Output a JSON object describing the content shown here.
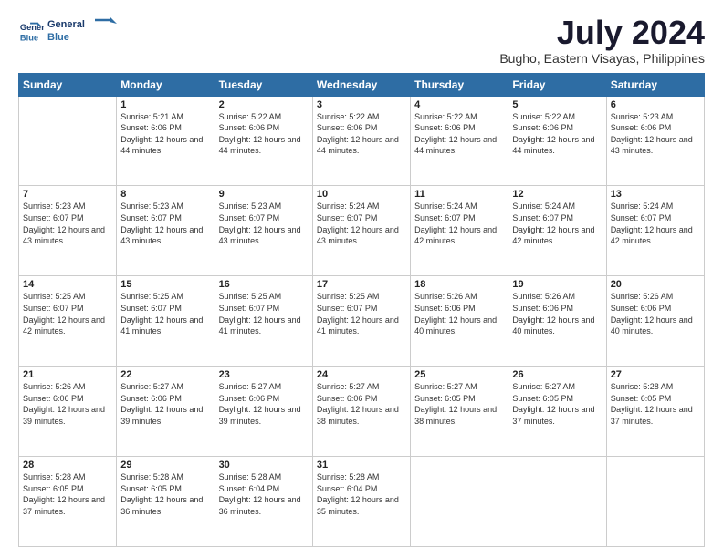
{
  "header": {
    "logo_line1": "General",
    "logo_line2": "Blue",
    "title": "July 2024",
    "subtitle": "Bugho, Eastern Visayas, Philippines"
  },
  "days_of_week": [
    "Sunday",
    "Monday",
    "Tuesday",
    "Wednesday",
    "Thursday",
    "Friday",
    "Saturday"
  ],
  "weeks": [
    [
      {
        "day": "",
        "sunrise": "",
        "sunset": "",
        "daylight": ""
      },
      {
        "day": "1",
        "sunrise": "Sunrise: 5:21 AM",
        "sunset": "Sunset: 6:06 PM",
        "daylight": "Daylight: 12 hours and 44 minutes."
      },
      {
        "day": "2",
        "sunrise": "Sunrise: 5:22 AM",
        "sunset": "Sunset: 6:06 PM",
        "daylight": "Daylight: 12 hours and 44 minutes."
      },
      {
        "day": "3",
        "sunrise": "Sunrise: 5:22 AM",
        "sunset": "Sunset: 6:06 PM",
        "daylight": "Daylight: 12 hours and 44 minutes."
      },
      {
        "day": "4",
        "sunrise": "Sunrise: 5:22 AM",
        "sunset": "Sunset: 6:06 PM",
        "daylight": "Daylight: 12 hours and 44 minutes."
      },
      {
        "day": "5",
        "sunrise": "Sunrise: 5:22 AM",
        "sunset": "Sunset: 6:06 PM",
        "daylight": "Daylight: 12 hours and 44 minutes."
      },
      {
        "day": "6",
        "sunrise": "Sunrise: 5:23 AM",
        "sunset": "Sunset: 6:06 PM",
        "daylight": "Daylight: 12 hours and 43 minutes."
      }
    ],
    [
      {
        "day": "7",
        "sunrise": "Sunrise: 5:23 AM",
        "sunset": "Sunset: 6:07 PM",
        "daylight": "Daylight: 12 hours and 43 minutes."
      },
      {
        "day": "8",
        "sunrise": "Sunrise: 5:23 AM",
        "sunset": "Sunset: 6:07 PM",
        "daylight": "Daylight: 12 hours and 43 minutes."
      },
      {
        "day": "9",
        "sunrise": "Sunrise: 5:23 AM",
        "sunset": "Sunset: 6:07 PM",
        "daylight": "Daylight: 12 hours and 43 minutes."
      },
      {
        "day": "10",
        "sunrise": "Sunrise: 5:24 AM",
        "sunset": "Sunset: 6:07 PM",
        "daylight": "Daylight: 12 hours and 43 minutes."
      },
      {
        "day": "11",
        "sunrise": "Sunrise: 5:24 AM",
        "sunset": "Sunset: 6:07 PM",
        "daylight": "Daylight: 12 hours and 42 minutes."
      },
      {
        "day": "12",
        "sunrise": "Sunrise: 5:24 AM",
        "sunset": "Sunset: 6:07 PM",
        "daylight": "Daylight: 12 hours and 42 minutes."
      },
      {
        "day": "13",
        "sunrise": "Sunrise: 5:24 AM",
        "sunset": "Sunset: 6:07 PM",
        "daylight": "Daylight: 12 hours and 42 minutes."
      }
    ],
    [
      {
        "day": "14",
        "sunrise": "Sunrise: 5:25 AM",
        "sunset": "Sunset: 6:07 PM",
        "daylight": "Daylight: 12 hours and 42 minutes."
      },
      {
        "day": "15",
        "sunrise": "Sunrise: 5:25 AM",
        "sunset": "Sunset: 6:07 PM",
        "daylight": "Daylight: 12 hours and 41 minutes."
      },
      {
        "day": "16",
        "sunrise": "Sunrise: 5:25 AM",
        "sunset": "Sunset: 6:07 PM",
        "daylight": "Daylight: 12 hours and 41 minutes."
      },
      {
        "day": "17",
        "sunrise": "Sunrise: 5:25 AM",
        "sunset": "Sunset: 6:07 PM",
        "daylight": "Daylight: 12 hours and 41 minutes."
      },
      {
        "day": "18",
        "sunrise": "Sunrise: 5:26 AM",
        "sunset": "Sunset: 6:06 PM",
        "daylight": "Daylight: 12 hours and 40 minutes."
      },
      {
        "day": "19",
        "sunrise": "Sunrise: 5:26 AM",
        "sunset": "Sunset: 6:06 PM",
        "daylight": "Daylight: 12 hours and 40 minutes."
      },
      {
        "day": "20",
        "sunrise": "Sunrise: 5:26 AM",
        "sunset": "Sunset: 6:06 PM",
        "daylight": "Daylight: 12 hours and 40 minutes."
      }
    ],
    [
      {
        "day": "21",
        "sunrise": "Sunrise: 5:26 AM",
        "sunset": "Sunset: 6:06 PM",
        "daylight": "Daylight: 12 hours and 39 minutes."
      },
      {
        "day": "22",
        "sunrise": "Sunrise: 5:27 AM",
        "sunset": "Sunset: 6:06 PM",
        "daylight": "Daylight: 12 hours and 39 minutes."
      },
      {
        "day": "23",
        "sunrise": "Sunrise: 5:27 AM",
        "sunset": "Sunset: 6:06 PM",
        "daylight": "Daylight: 12 hours and 39 minutes."
      },
      {
        "day": "24",
        "sunrise": "Sunrise: 5:27 AM",
        "sunset": "Sunset: 6:06 PM",
        "daylight": "Daylight: 12 hours and 38 minutes."
      },
      {
        "day": "25",
        "sunrise": "Sunrise: 5:27 AM",
        "sunset": "Sunset: 6:05 PM",
        "daylight": "Daylight: 12 hours and 38 minutes."
      },
      {
        "day": "26",
        "sunrise": "Sunrise: 5:27 AM",
        "sunset": "Sunset: 6:05 PM",
        "daylight": "Daylight: 12 hours and 37 minutes."
      },
      {
        "day": "27",
        "sunrise": "Sunrise: 5:28 AM",
        "sunset": "Sunset: 6:05 PM",
        "daylight": "Daylight: 12 hours and 37 minutes."
      }
    ],
    [
      {
        "day": "28",
        "sunrise": "Sunrise: 5:28 AM",
        "sunset": "Sunset: 6:05 PM",
        "daylight": "Daylight: 12 hours and 37 minutes."
      },
      {
        "day": "29",
        "sunrise": "Sunrise: 5:28 AM",
        "sunset": "Sunset: 6:05 PM",
        "daylight": "Daylight: 12 hours and 36 minutes."
      },
      {
        "day": "30",
        "sunrise": "Sunrise: 5:28 AM",
        "sunset": "Sunset: 6:04 PM",
        "daylight": "Daylight: 12 hours and 36 minutes."
      },
      {
        "day": "31",
        "sunrise": "Sunrise: 5:28 AM",
        "sunset": "Sunset: 6:04 PM",
        "daylight": "Daylight: 12 hours and 35 minutes."
      },
      {
        "day": "",
        "sunrise": "",
        "sunset": "",
        "daylight": ""
      },
      {
        "day": "",
        "sunrise": "",
        "sunset": "",
        "daylight": ""
      },
      {
        "day": "",
        "sunrise": "",
        "sunset": "",
        "daylight": ""
      }
    ]
  ]
}
